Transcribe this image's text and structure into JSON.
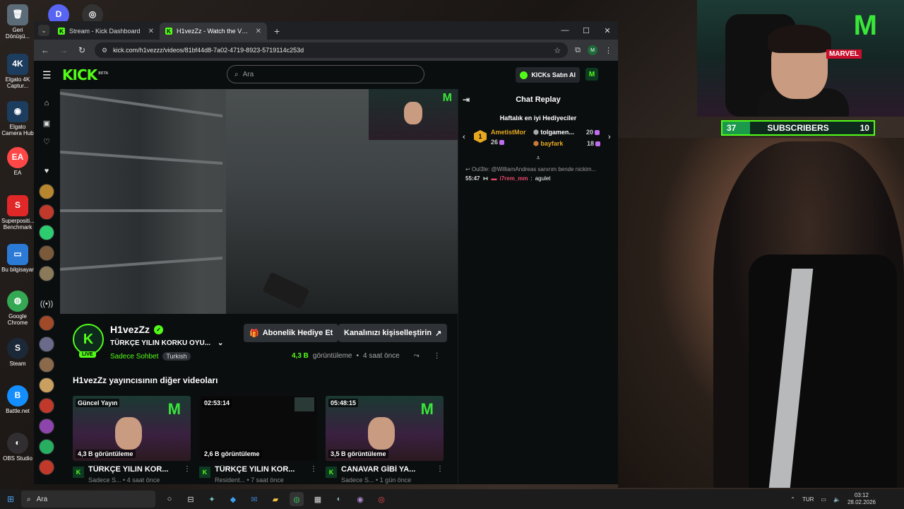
{
  "desktop": {
    "icons": [
      {
        "label": "Geri Dönüşü...",
        "glyph": "🗑",
        "color": "#5b6b78"
      },
      {
        "label": "",
        "glyph": "D",
        "color": "#5865f2"
      },
      {
        "label": "",
        "glyph": "◎",
        "color": "#333333"
      },
      {
        "label": "Elgato 4K Captur...",
        "glyph": "4K",
        "color": "#1d3d5e"
      },
      {
        "label": "Elgato Camera Hub",
        "glyph": "◉",
        "color": "#1d3d5e"
      },
      {
        "label": "EA",
        "glyph": "EA",
        "color": "#ff4747"
      },
      {
        "label": "Superpositi... Benchmark",
        "glyph": "S",
        "color": "#e02828"
      },
      {
        "label": "Bu bilgisayar",
        "glyph": "▭",
        "color": "#2b7bd6"
      },
      {
        "label": "Google Chrome",
        "glyph": "◍",
        "color": "#34a853"
      },
      {
        "label": "Steam",
        "glyph": "S",
        "color": "#1b2838"
      },
      {
        "label": "Battle.net",
        "glyph": "B",
        "color": "#148eff"
      },
      {
        "label": "OBS Studio",
        "glyph": "◐",
        "color": "#302e31"
      }
    ]
  },
  "overlay": {
    "subscribers_current": "37",
    "subscribers_label": "SUBSCRIBERS",
    "subscribers_goal": "10",
    "subscribers_fill": 0.18
  },
  "browser": {
    "tabs": [
      {
        "title": "Stream - Kick Dashboard",
        "active": false
      },
      {
        "title": "H1vezZz - Watch the VOD on Kick",
        "active": true
      }
    ],
    "url": "kick.com/h1vezzz/videos/81bf44d8-7a02-4719-8923-5719114c253d"
  },
  "kick": {
    "logo": "KICK",
    "logo_beta": "BETA",
    "search_placeholder": "Ara",
    "buy_kicks": "KICKs Satın Al",
    "channel": {
      "name": "H1vezZz",
      "live_badge": "LIVE",
      "stream_title": "TÜRKÇE YILIN KORKU OYU...",
      "category": "Sadece Sohbet",
      "language": "Turkish",
      "views_count": "4,3 B",
      "views_label": "görüntüleme",
      "time_ago": "4 saat önce",
      "gift_button": "Abonelik Hediye Et",
      "customize_button": "Kanalınızı kişiselleştirin"
    },
    "other_videos_title": "H1vezZz yayıncısının diğer videoları",
    "videos": [
      {
        "badge": "Güncel Yayın",
        "views": "4,3 B görüntüleme",
        "title": "TÜRKÇE YILIN KOR...",
        "sub": "Sadece S... • 4 saat önce"
      },
      {
        "badge": "02:53:14",
        "views": "2,6 B görüntüleme",
        "title": "TÜRKÇE YILIN KOR...",
        "sub": "Resident... • 7 saat önce"
      },
      {
        "badge": "05:48:15",
        "views": "3,5 B görüntüleme",
        "title": "CANAVAR GİBİ YA...",
        "sub": "Sadece S... • 1 gün önce"
      }
    ],
    "chat": {
      "title": "Chat Replay",
      "leaderboard_title": "Haftalık en iyi Hediyeciler",
      "leaders": [
        {
          "rank": "1",
          "name": "AmetistMor",
          "count": "26"
        },
        {
          "name": "tolgamen...",
          "count": "20"
        },
        {
          "name": "bayfark",
          "count": "18"
        }
      ],
      "reply_line": "Oul3le: @WilliamAndreas sanırım bende nickim...",
      "message": {
        "time": "55:47",
        "user": "i7rem_mm",
        "text": "agulet"
      }
    }
  },
  "taskbar": {
    "search": "Ara",
    "lang": "TUR",
    "time": "03:12",
    "date": "28.02.2026"
  }
}
